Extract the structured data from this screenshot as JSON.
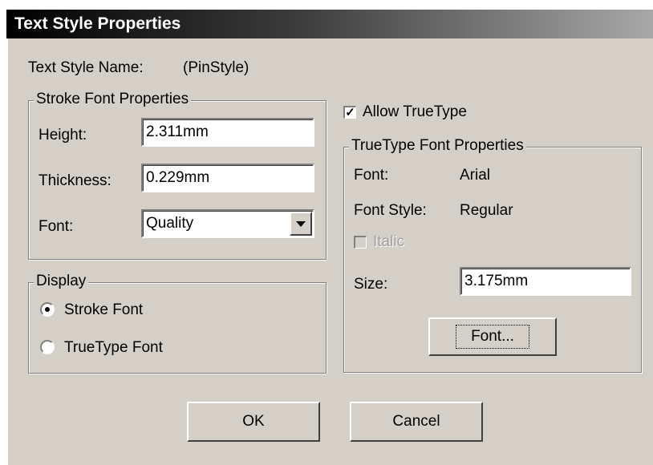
{
  "dialog": {
    "title": "Text Style Properties"
  },
  "style_name": {
    "label": "Text Style Name:",
    "value": "(PinStyle)"
  },
  "stroke_font": {
    "legend": "Stroke Font Properties",
    "height_label": "Height:",
    "height_value": "2.311mm",
    "thickness_label": "Thickness:",
    "thickness_value": "0.229mm",
    "font_label": "Font:",
    "font_value": "Quality"
  },
  "display": {
    "legend": "Display",
    "stroke_option": "Stroke Font",
    "truetype_option": "TrueType Font",
    "selected": "Stroke Font"
  },
  "allow_truetype": {
    "label": "Allow TrueType",
    "checked": true
  },
  "truetype_font": {
    "legend": "TrueType Font Properties",
    "font_label": "Font:",
    "font_value": "Arial",
    "style_label": "Font Style:",
    "style_value": "Regular",
    "italic_label": "Italic",
    "italic_checked": false,
    "size_label": "Size:",
    "size_value": "3.175mm",
    "font_button": "Font..."
  },
  "buttons": {
    "ok": "OK",
    "cancel": "Cancel"
  }
}
